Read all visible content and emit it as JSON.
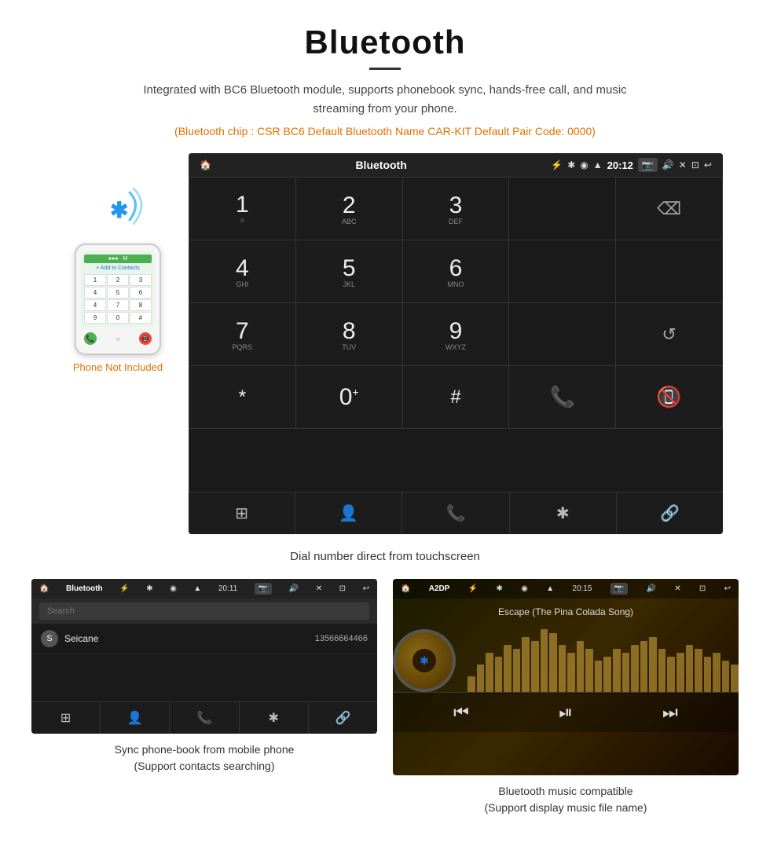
{
  "header": {
    "title": "Bluetooth",
    "description": "Integrated with BC6 Bluetooth module, supports phonebook sync, hands-free call, and music streaming from your phone.",
    "note": "(Bluetooth chip : CSR BC6    Default Bluetooth Name CAR-KIT    Default Pair Code: 0000)"
  },
  "phone_label": "Phone Not Included",
  "car_screen": {
    "status_bar": {
      "left_icon": "🏠",
      "title": "Bluetooth",
      "usb_icon": "⚡",
      "bt_icon": "✱",
      "loc_icon": "◉",
      "signal": "▲",
      "time": "20:12",
      "camera_icon": "📷",
      "volume_icon": "🔊",
      "close_icon": "✕",
      "window_icon": "⊡",
      "back_icon": "↩"
    },
    "keypad": [
      {
        "number": "1",
        "letters": "⌾"
      },
      {
        "number": "2",
        "letters": "ABC"
      },
      {
        "number": "3",
        "letters": "DEF"
      },
      {
        "number": "",
        "letters": ""
      },
      {
        "number": "⌫",
        "letters": ""
      },
      {
        "number": "4",
        "letters": "GHI"
      },
      {
        "number": "5",
        "letters": "JKL"
      },
      {
        "number": "6",
        "letters": "MNO"
      },
      {
        "number": "",
        "letters": ""
      },
      {
        "number": "",
        "letters": ""
      },
      {
        "number": "7",
        "letters": "PQRS"
      },
      {
        "number": "8",
        "letters": "TUV"
      },
      {
        "number": "9",
        "letters": "WXYZ"
      },
      {
        "number": "",
        "letters": ""
      },
      {
        "number": "↺",
        "letters": ""
      },
      {
        "number": "*",
        "letters": ""
      },
      {
        "number": "0",
        "letters": "+"
      },
      {
        "number": "#",
        "letters": ""
      },
      {
        "number": "📞",
        "letters": ""
      },
      {
        "number": "📵",
        "letters": ""
      }
    ],
    "toolbar": [
      "⊞",
      "👤",
      "📞",
      "✱",
      "🔗"
    ]
  },
  "caption": "Dial number direct from touchscreen",
  "phonebook_screen": {
    "status_bar_title": "Bluetooth",
    "time": "20:11",
    "search_placeholder": "Search",
    "contacts": [
      {
        "initial": "S",
        "name": "Seicane",
        "number": "13566664466"
      }
    ],
    "toolbar": [
      "⊞",
      "👤",
      "📞",
      "✱",
      "🔗"
    ]
  },
  "phonebook_caption": "Sync phone-book from mobile phone\n(Support contacts searching)",
  "music_screen": {
    "status_bar_title": "A2DP",
    "time": "20:15",
    "song_title": "Escape (The Pina Colada Song)",
    "viz_bars": [
      20,
      35,
      50,
      45,
      60,
      55,
      70,
      65,
      80,
      75,
      60,
      50,
      65,
      55,
      40,
      45,
      55,
      50,
      60,
      65,
      70,
      55,
      45,
      50,
      60,
      55,
      45,
      50,
      40,
      35
    ],
    "controls": [
      "⏮",
      "⏯",
      "⏭"
    ]
  },
  "music_caption": "Bluetooth music compatible\n(Support display music file name)"
}
